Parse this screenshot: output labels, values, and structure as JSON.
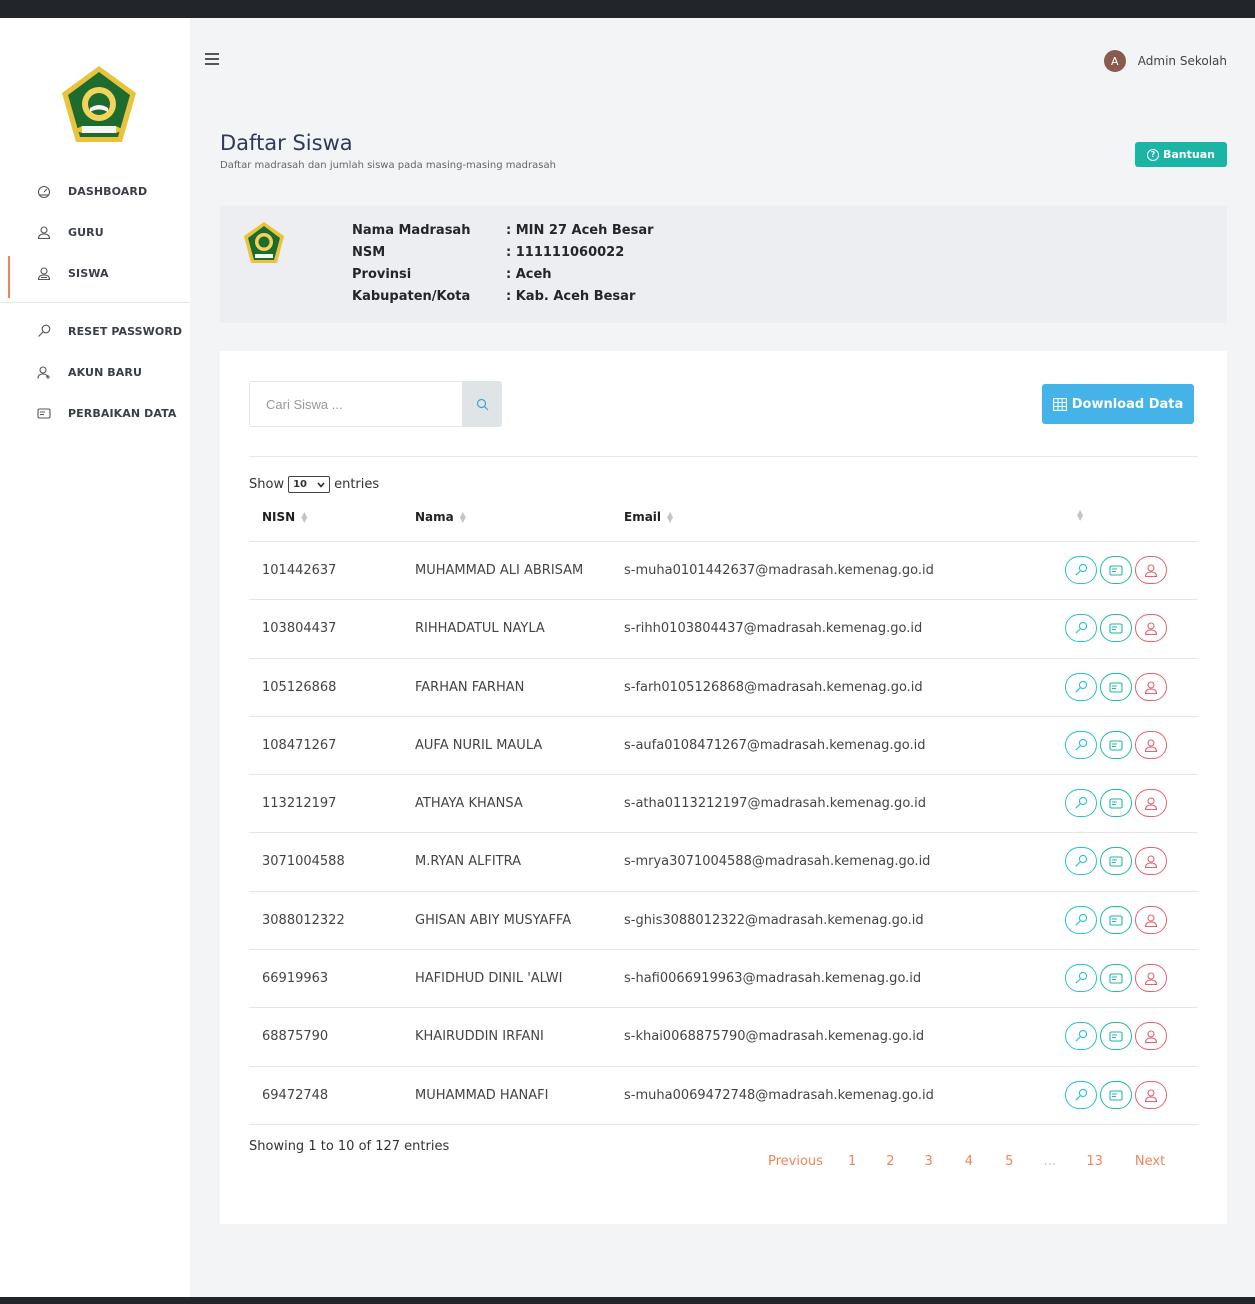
{
  "sidebar": {
    "items": [
      {
        "label": "DASHBOARD",
        "icon": "dashboard-icon"
      },
      {
        "label": "GURU",
        "icon": "user-icon"
      },
      {
        "label": "SISWA",
        "icon": "users-icon"
      },
      {
        "label": "RESET PASSWORD",
        "icon": "key-icon"
      },
      {
        "label": "AKUN BARU",
        "icon": "add-user-icon"
      },
      {
        "label": "PERBAIKAN DATA",
        "icon": "id-card-icon"
      }
    ],
    "active": "SISWA"
  },
  "header": {
    "avatar_letter": "A",
    "user_name": "Admin Sekolah"
  },
  "page": {
    "title": "Daftar Siswa",
    "subtitle": "Daftar madrasah dan jumlah siswa pada masing-masing madrasah",
    "help_label": "Bantuan"
  },
  "info": {
    "labels": [
      "Nama Madrasah",
      "NSM",
      "Provinsi",
      "Kabupaten/Kota"
    ],
    "values": [
      ": MIN 27 Aceh Besar",
      ": 111111060022",
      ": Aceh",
      ": Kab. Aceh Besar"
    ]
  },
  "toolbar": {
    "search_placeholder": "Cari Siswa ...",
    "download_label": "Download Data"
  },
  "table": {
    "show_prefix": "Show",
    "show_value": "10",
    "show_suffix": "entries",
    "headers": [
      "NISN",
      "Nama",
      "Email",
      ""
    ],
    "rows": [
      {
        "nisn": "101442637",
        "nama": "MUHAMMAD ALI ABRISAM",
        "email": "s-muha0101442637@madrasah.kemenag.go.id"
      },
      {
        "nisn": "103804437",
        "nama": "RIHHADATUL NAYLA",
        "email": "s-rihh0103804437@madrasah.kemenag.go.id"
      },
      {
        "nisn": "105126868",
        "nama": "FARHAN FARHAN",
        "email": "s-farh0105126868@madrasah.kemenag.go.id"
      },
      {
        "nisn": "108471267",
        "nama": "AUFA NURIL MAULA",
        "email": "s-aufa0108471267@madrasah.kemenag.go.id"
      },
      {
        "nisn": "113212197",
        "nama": "ATHAYA KHANSA",
        "email": "s-atha0113212197@madrasah.kemenag.go.id"
      },
      {
        "nisn": "3071004588",
        "nama": "M.RYAN ALFITRA",
        "email": "s-mrya3071004588@madrasah.kemenag.go.id"
      },
      {
        "nisn": "3088012322",
        "nama": "GHISAN ABIY MUSYAFFA",
        "email": "s-ghis3088012322@madrasah.kemenag.go.id"
      },
      {
        "nisn": "66919963",
        "nama": "HAFIDHUD DINIL 'ALWI",
        "email": "s-hafi0066919963@madrasah.kemenag.go.id"
      },
      {
        "nisn": "68875790",
        "nama": "KHAIRUDDIN IRFANI",
        "email": "s-khai0068875790@madrasah.kemenag.go.id"
      },
      {
        "nisn": "69472748",
        "nama": "MUHAMMAD HANAFI",
        "email": "s-muha0069472748@madrasah.kemenag.go.id"
      }
    ],
    "showing": "Showing 1 to 10 of 127 entries"
  },
  "pagination": {
    "previous": "Previous",
    "pages": [
      "1",
      "2",
      "3",
      "4",
      "5",
      "…",
      "13"
    ],
    "next": "Next"
  },
  "colors": {
    "accent": "#f0855a",
    "teal": "#1ab5a5",
    "blue": "#45b3e7",
    "danger": "#e5636b"
  }
}
